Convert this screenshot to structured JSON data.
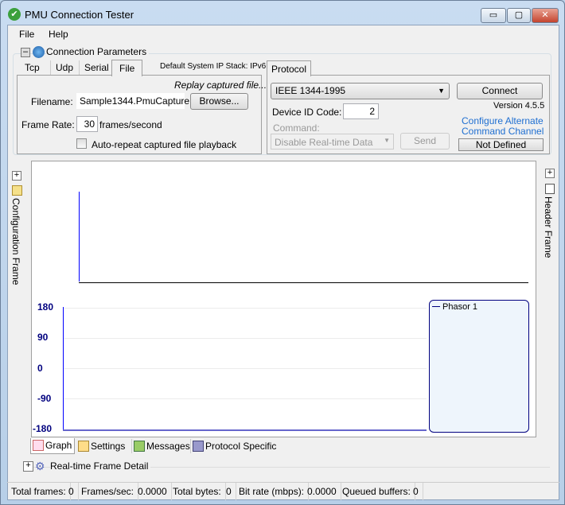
{
  "window": {
    "title": "PMU Connection Tester",
    "minimize": "▭",
    "maximize": "▢",
    "close": "✕"
  },
  "menu": [
    "File",
    "Help"
  ],
  "connection": {
    "group_label": "Connection Parameters",
    "tabs": [
      "Tcp",
      "Udp",
      "Serial",
      "File"
    ],
    "active_tab": "File",
    "ip_stack": "Default System IP Stack: IPv6",
    "file": {
      "hint": "Replay captured file...",
      "filename_label": "Filename:",
      "filename_value": "Sample1344.PmuCapture",
      "browse": "Browse...",
      "frame_rate_label": "Frame Rate:",
      "frame_rate_value": "30",
      "frame_rate_unit": "frames/second",
      "auto_repeat_label": "Auto-repeat captured file playback",
      "auto_repeat_checked": false
    }
  },
  "protocol": {
    "tab": "Protocol",
    "selected": "IEEE 1344-1995",
    "device_id_label": "Device ID Code:",
    "device_id_value": "2",
    "command_label": "Command:",
    "command_value": "Disable Real-time Data",
    "send": "Send",
    "connect": "Connect",
    "version": "Version 4.5.5",
    "alt_channel_link": "Configure Alternate Command Channel",
    "alt_channel_value": "Not Defined"
  },
  "side": {
    "left": "Configuration Frame",
    "right": "Header Frame"
  },
  "graph": {
    "y_ticks": [
      "180",
      "90",
      "0",
      "-90",
      "-180"
    ],
    "legend": [
      "Phasor 1"
    ],
    "colors": {
      "axis": "#00007f",
      "series": "#0000ff"
    }
  },
  "bottom_tabs": [
    "Graph",
    "Settings",
    "Messages",
    "Protocol Specific"
  ],
  "detail_label": "Real-time Frame Detail",
  "status": [
    {
      "label": "Total frames:",
      "value": "0"
    },
    {
      "label": "Frames/sec:",
      "value": "0.0000"
    },
    {
      "label": "Total bytes:",
      "value": "0"
    },
    {
      "label": "Bit rate (mbps):",
      "value": "0.0000"
    },
    {
      "label": "Queued buffers:",
      "value": "0"
    }
  ]
}
